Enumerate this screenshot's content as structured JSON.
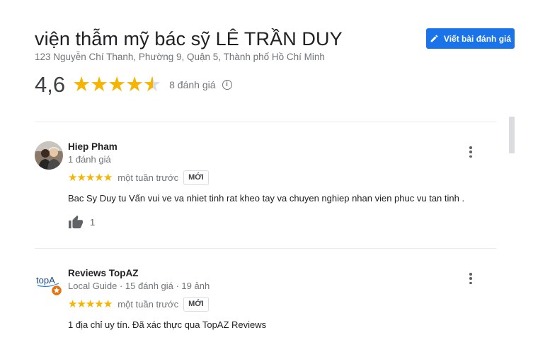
{
  "place": {
    "title": "viện thẫm mỹ bác sỹ LÊ TRẦN DUY",
    "address": "123 Nguyễn Chí Thanh, Phường 9, Quận 5, Thành phố Hồ Chí Minh"
  },
  "actions": {
    "write_review_label": "Viết bài đánh giá",
    "write_review_icon": "pencil-icon"
  },
  "summary": {
    "rating": "4,6",
    "rating_value": 4.6,
    "max_rating": 5,
    "review_count_text": "8 đánh giá",
    "info_icon": "info-icon",
    "star_color": "#f4b400"
  },
  "reviews": [
    {
      "name": "Hiep Pham",
      "meta": "1 đánh giá",
      "stars": 5,
      "time": "một tuần trước",
      "badge": "MỚI",
      "text": "Bac Sy Duy tu Vấn vui ve va nhiet tinh rat kheo tay va chuyen nghiep nhan vien phuc vu tan tinh .",
      "likes": "1",
      "like_icon": "thumbs-up-icon"
    },
    {
      "name": "Reviews TopAZ",
      "meta": "Local Guide · 15 đánh giá · 19 ảnh",
      "stars": 5,
      "time": "một tuần trước",
      "badge": "MỚI",
      "text": "1 địa chỉ uy tín. Đã xác thực qua TopAZ Reviews",
      "avatar_logo_text": "topA"
    }
  ],
  "colors": {
    "accent": "#1a73e8",
    "star": "#f4b400",
    "secondary_text": "#70757a"
  }
}
